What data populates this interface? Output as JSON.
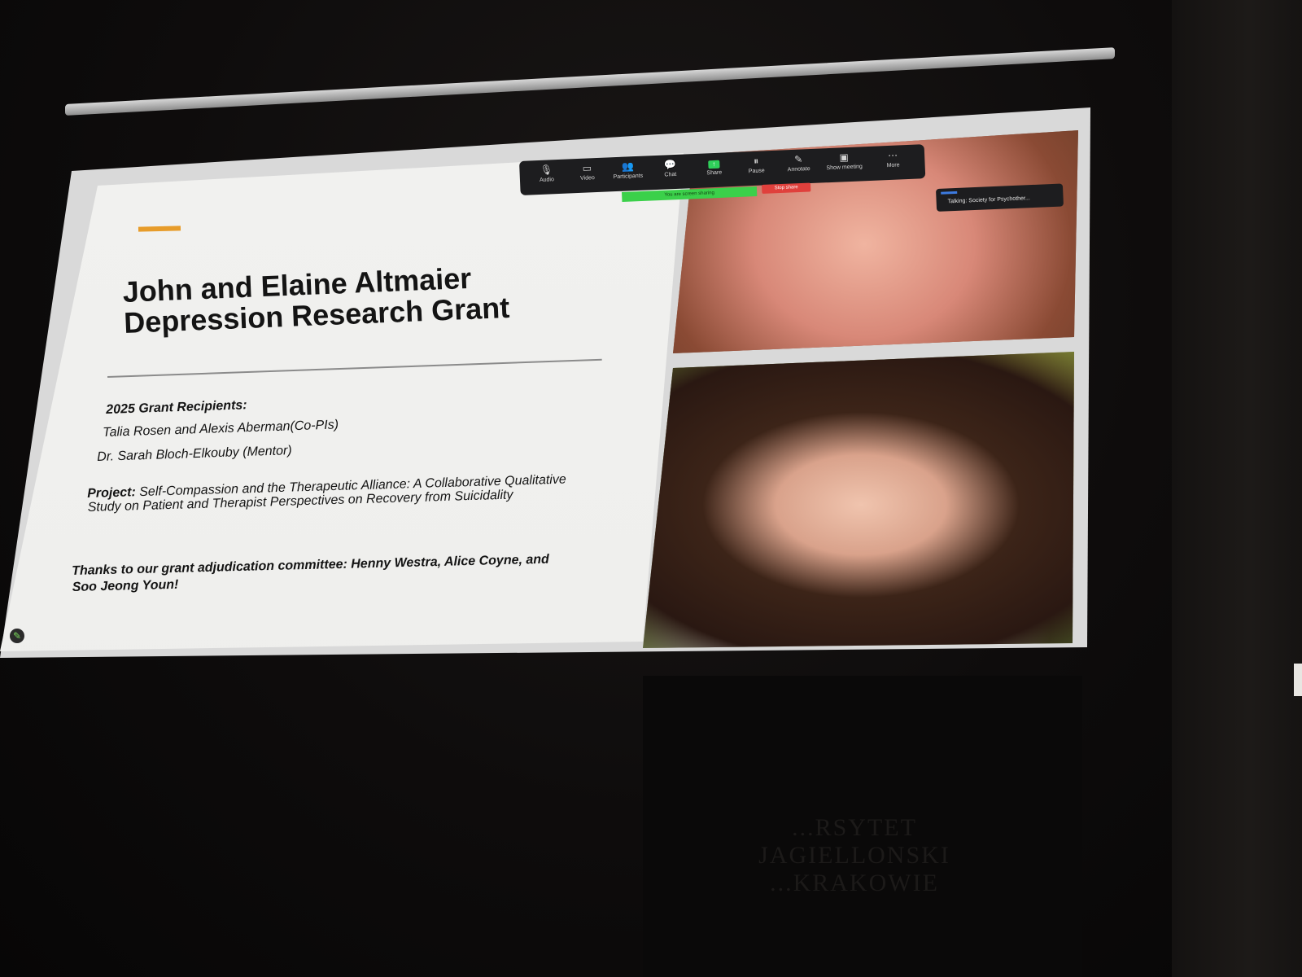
{
  "slide": {
    "title_line1": "John and Elaine Altmaier",
    "title_line2": "Depression Research Grant",
    "recipients_label": "2025 Grant Recipients:",
    "recipient_1": "Talia Rosen and Alexis Aberman(Co-PIs)",
    "recipient_2": "Dr. Sarah Bloch-Elkouby (Mentor)",
    "project_label": "Project:",
    "project_text": " Self-Compassion and the Therapeutic Alliance: A Collaborative Qualitative Study on Patient and Therapist Perspectives on Recovery from Suicidality",
    "thanks": "Thanks to our grant adjudication committee: Henny Westra, Alice Coyne, and Soo Jeong Youn!",
    "accent_color": "#e79c2a"
  },
  "zoom": {
    "toolbar": [
      {
        "label": "Audio",
        "icon": "microphone-icon",
        "glyph": "🎙"
      },
      {
        "label": "Video",
        "icon": "video-camera-icon",
        "glyph": "▭"
      },
      {
        "label": "Participants",
        "icon": "participants-icon",
        "glyph": "👥"
      },
      {
        "label": "Chat",
        "icon": "chat-icon",
        "glyph": "💬"
      },
      {
        "label": "Share",
        "icon": "share-screen-icon",
        "glyph": "↑"
      },
      {
        "label": "Pause",
        "icon": "pause-icon",
        "glyph": "⏸"
      },
      {
        "label": "Annotate",
        "icon": "pencil-icon",
        "glyph": "✎"
      },
      {
        "label": "Show meeting",
        "icon": "show-meeting-icon",
        "glyph": "▣"
      },
      {
        "label": "More",
        "icon": "more-icon",
        "glyph": "⋯"
      }
    ],
    "sharing_banner": "You are screen sharing",
    "stop_share": "Stop share",
    "talking": "Talking: Society for Psychother...",
    "sharing_color": "#3bd04a",
    "stop_color": "#e0403c"
  },
  "room": {
    "pillar_text": "...RSYTET\nJAGIELLONSKI\n...KRAKOWIE"
  }
}
